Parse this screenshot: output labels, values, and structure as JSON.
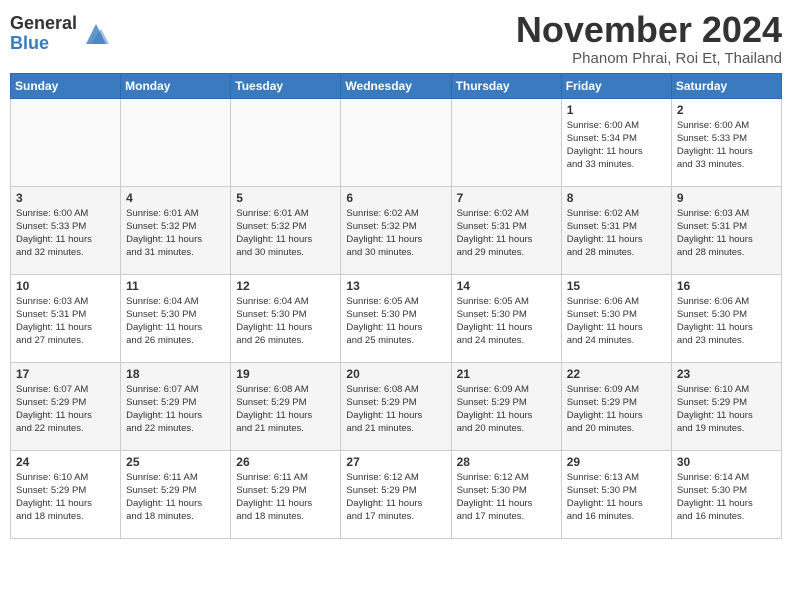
{
  "header": {
    "logo_general": "General",
    "logo_blue": "Blue",
    "month": "November 2024",
    "location": "Phanom Phrai, Roi Et, Thailand"
  },
  "weekdays": [
    "Sunday",
    "Monday",
    "Tuesday",
    "Wednesday",
    "Thursday",
    "Friday",
    "Saturday"
  ],
  "weeks": [
    [
      {
        "day": "",
        "info": ""
      },
      {
        "day": "",
        "info": ""
      },
      {
        "day": "",
        "info": ""
      },
      {
        "day": "",
        "info": ""
      },
      {
        "day": "",
        "info": ""
      },
      {
        "day": "1",
        "info": "Sunrise: 6:00 AM\nSunset: 5:34 PM\nDaylight: 11 hours\nand 33 minutes."
      },
      {
        "day": "2",
        "info": "Sunrise: 6:00 AM\nSunset: 5:33 PM\nDaylight: 11 hours\nand 33 minutes."
      }
    ],
    [
      {
        "day": "3",
        "info": "Sunrise: 6:00 AM\nSunset: 5:33 PM\nDaylight: 11 hours\nand 32 minutes."
      },
      {
        "day": "4",
        "info": "Sunrise: 6:01 AM\nSunset: 5:32 PM\nDaylight: 11 hours\nand 31 minutes."
      },
      {
        "day": "5",
        "info": "Sunrise: 6:01 AM\nSunset: 5:32 PM\nDaylight: 11 hours\nand 30 minutes."
      },
      {
        "day": "6",
        "info": "Sunrise: 6:02 AM\nSunset: 5:32 PM\nDaylight: 11 hours\nand 30 minutes."
      },
      {
        "day": "7",
        "info": "Sunrise: 6:02 AM\nSunset: 5:31 PM\nDaylight: 11 hours\nand 29 minutes."
      },
      {
        "day": "8",
        "info": "Sunrise: 6:02 AM\nSunset: 5:31 PM\nDaylight: 11 hours\nand 28 minutes."
      },
      {
        "day": "9",
        "info": "Sunrise: 6:03 AM\nSunset: 5:31 PM\nDaylight: 11 hours\nand 28 minutes."
      }
    ],
    [
      {
        "day": "10",
        "info": "Sunrise: 6:03 AM\nSunset: 5:31 PM\nDaylight: 11 hours\nand 27 minutes."
      },
      {
        "day": "11",
        "info": "Sunrise: 6:04 AM\nSunset: 5:30 PM\nDaylight: 11 hours\nand 26 minutes."
      },
      {
        "day": "12",
        "info": "Sunrise: 6:04 AM\nSunset: 5:30 PM\nDaylight: 11 hours\nand 26 minutes."
      },
      {
        "day": "13",
        "info": "Sunrise: 6:05 AM\nSunset: 5:30 PM\nDaylight: 11 hours\nand 25 minutes."
      },
      {
        "day": "14",
        "info": "Sunrise: 6:05 AM\nSunset: 5:30 PM\nDaylight: 11 hours\nand 24 minutes."
      },
      {
        "day": "15",
        "info": "Sunrise: 6:06 AM\nSunset: 5:30 PM\nDaylight: 11 hours\nand 24 minutes."
      },
      {
        "day": "16",
        "info": "Sunrise: 6:06 AM\nSunset: 5:30 PM\nDaylight: 11 hours\nand 23 minutes."
      }
    ],
    [
      {
        "day": "17",
        "info": "Sunrise: 6:07 AM\nSunset: 5:29 PM\nDaylight: 11 hours\nand 22 minutes."
      },
      {
        "day": "18",
        "info": "Sunrise: 6:07 AM\nSunset: 5:29 PM\nDaylight: 11 hours\nand 22 minutes."
      },
      {
        "day": "19",
        "info": "Sunrise: 6:08 AM\nSunset: 5:29 PM\nDaylight: 11 hours\nand 21 minutes."
      },
      {
        "day": "20",
        "info": "Sunrise: 6:08 AM\nSunset: 5:29 PM\nDaylight: 11 hours\nand 21 minutes."
      },
      {
        "day": "21",
        "info": "Sunrise: 6:09 AM\nSunset: 5:29 PM\nDaylight: 11 hours\nand 20 minutes."
      },
      {
        "day": "22",
        "info": "Sunrise: 6:09 AM\nSunset: 5:29 PM\nDaylight: 11 hours\nand 20 minutes."
      },
      {
        "day": "23",
        "info": "Sunrise: 6:10 AM\nSunset: 5:29 PM\nDaylight: 11 hours\nand 19 minutes."
      }
    ],
    [
      {
        "day": "24",
        "info": "Sunrise: 6:10 AM\nSunset: 5:29 PM\nDaylight: 11 hours\nand 18 minutes."
      },
      {
        "day": "25",
        "info": "Sunrise: 6:11 AM\nSunset: 5:29 PM\nDaylight: 11 hours\nand 18 minutes."
      },
      {
        "day": "26",
        "info": "Sunrise: 6:11 AM\nSunset: 5:29 PM\nDaylight: 11 hours\nand 18 minutes."
      },
      {
        "day": "27",
        "info": "Sunrise: 6:12 AM\nSunset: 5:29 PM\nDaylight: 11 hours\nand 17 minutes."
      },
      {
        "day": "28",
        "info": "Sunrise: 6:12 AM\nSunset: 5:30 PM\nDaylight: 11 hours\nand 17 minutes."
      },
      {
        "day": "29",
        "info": "Sunrise: 6:13 AM\nSunset: 5:30 PM\nDaylight: 11 hours\nand 16 minutes."
      },
      {
        "day": "30",
        "info": "Sunrise: 6:14 AM\nSunset: 5:30 PM\nDaylight: 11 hours\nand 16 minutes."
      }
    ]
  ]
}
